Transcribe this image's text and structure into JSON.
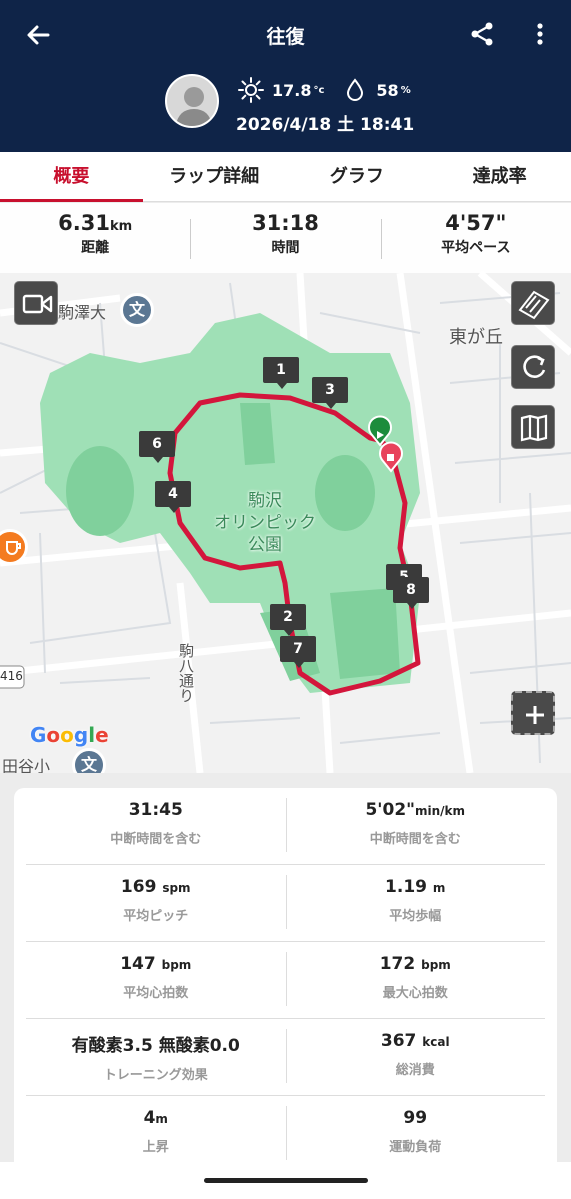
{
  "header": {
    "title": "往復",
    "temperature": "17.8",
    "temperature_unit": "°c",
    "humidity": "58",
    "humidity_unit": "%",
    "datetime": "2026/4/18 土 18:41",
    "bg_color": "#0f2448"
  },
  "tabs": [
    {
      "label": "概要",
      "active": true
    },
    {
      "label": "ラップ詳細",
      "active": false
    },
    {
      "label": "グラフ",
      "active": false
    },
    {
      "label": "達成率",
      "active": false
    }
  ],
  "summary": {
    "distance": {
      "value": "6.31",
      "unit": "km",
      "label": "距離"
    },
    "time": {
      "value": "31:18",
      "label": "時間"
    },
    "pace": {
      "value": "4'57\"",
      "label": "平均ペース"
    }
  },
  "map": {
    "park_label": "駒沢\nオリンピック\n公園",
    "place_labels": [
      "駒澤大",
      "東が丘",
      "駒八通り",
      "田谷小",
      "416"
    ],
    "lap_markers": [
      "1",
      "2",
      "3",
      "4",
      "5",
      "6",
      "7",
      "8"
    ],
    "attribution": "Google",
    "icons": [
      "video-icon",
      "map-style-icon",
      "loop-icon",
      "map-layers-icon",
      "zoom-in-icon",
      "school-icon",
      "cafe-icon"
    ],
    "route_color": "#d3163c"
  },
  "details": [
    [
      {
        "value": "31:45",
        "unit": "",
        "label": "中断時間を含む"
      },
      {
        "value": "5'02\"",
        "unit": "min/km",
        "label": "中断時間を含む"
      }
    ],
    [
      {
        "value": "169",
        "unit": "spm",
        "label": "平均ピッチ"
      },
      {
        "value": "1.19",
        "unit": "m",
        "label": "平均歩幅"
      }
    ],
    [
      {
        "value": "147",
        "unit": "bpm",
        "label": "平均心拍数"
      },
      {
        "value": "172",
        "unit": "bpm",
        "label": "最大心拍数"
      }
    ],
    [
      {
        "value": "有酸素3.5 無酸素0.0",
        "unit": "",
        "label": "トレーニング効果"
      },
      {
        "value": "367",
        "unit": "kcal",
        "label": "総消費"
      }
    ],
    [
      {
        "value": "4",
        "unit": "m",
        "label": "上昇"
      },
      {
        "value": "99",
        "unit": "",
        "label": "運動負荷"
      }
    ]
  ],
  "accent_color": "#c8102e"
}
